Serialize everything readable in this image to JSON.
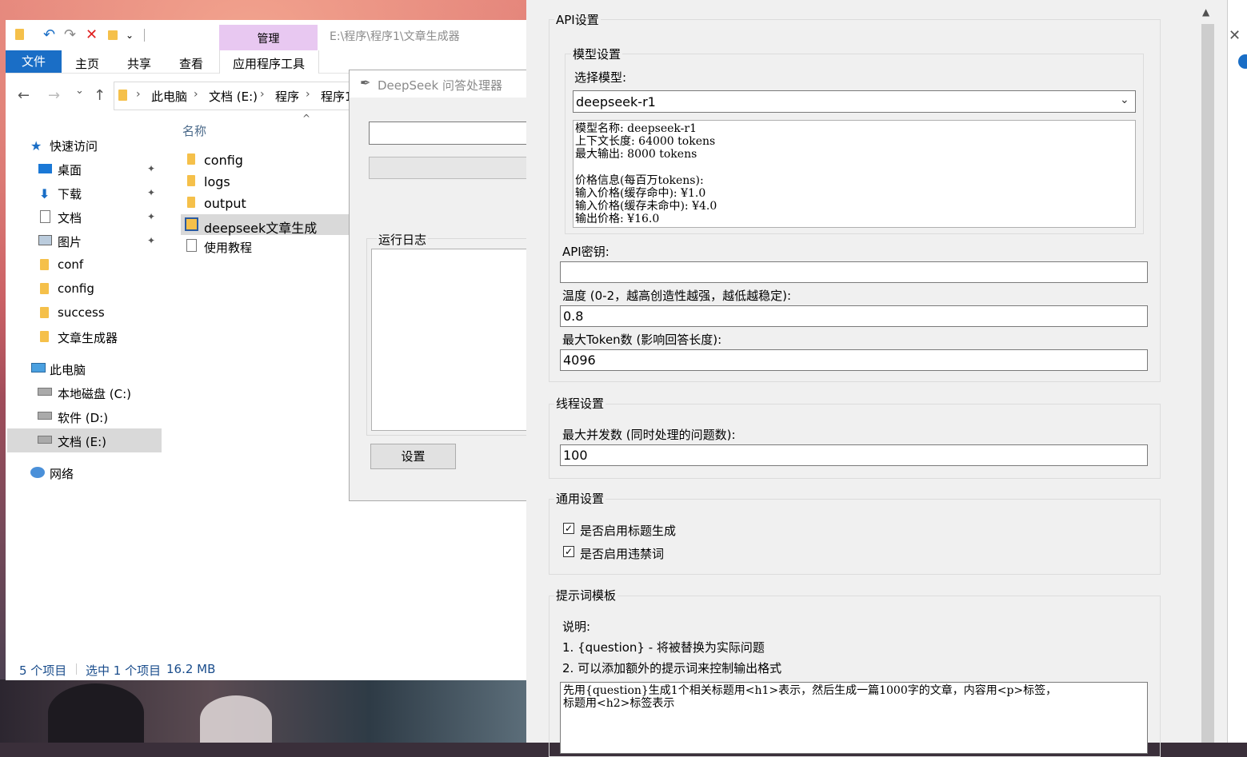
{
  "explorer": {
    "path_title": "E:\\程序\\程序1\\文章生成器",
    "manage_tab": "管理",
    "app_tools_tab": "应用程序工具",
    "ribbon_tabs": [
      "文件",
      "主页",
      "共享",
      "查看"
    ],
    "breadcrumbs": [
      "此电脑",
      "文档 (E:)",
      "程序",
      "程序1"
    ],
    "column_name": "名称",
    "nav": {
      "quick_access": "快速访问",
      "pinned": [
        "桌面",
        "下载",
        "文档",
        "图片"
      ],
      "folders": [
        "conf",
        "config",
        "success",
        "文章生成器"
      ],
      "this_pc": "此电脑",
      "drives": [
        "本地磁盘 (C:)",
        "软件 (D:)",
        "文档 (E:)"
      ],
      "network": "网络"
    },
    "files": [
      "config",
      "logs",
      "output",
      "deepseek文章生成",
      "使用教程"
    ],
    "status": {
      "count": "5 个项目",
      "selected": "选中 1 个项目",
      "size": "16.2 MB"
    }
  },
  "processor_window": {
    "title": "DeepSeek 问答处理器",
    "log_label": "运行日志",
    "settings_button": "设置"
  },
  "settings": {
    "api_section": "API设置",
    "model_section": "模型设置",
    "select_model_label": "选择模型:",
    "selected_model": "deepseek-r1",
    "model_info": [
      "模型名称: deepseek-r1",
      "上下文长度: 64000 tokens",
      "最大输出: 8000 tokens",
      "",
      "价格信息(每百万tokens):",
      "输入价格(缓存命中): ¥1.0",
      "输入价格(缓存未命中): ¥4.0",
      "输出价格: ¥16.0"
    ],
    "api_key_label": "API密钥:",
    "api_key_value": "",
    "temperature_label": "温度 (0-2，越高创造性越强，越低越稳定):",
    "temperature_value": "0.8",
    "max_tokens_label": "最大Token数 (影响回答长度):",
    "max_tokens_value": "4096",
    "thread_section": "线程设置",
    "max_concurrency_label": "最大并发数 (同时处理的问题数):",
    "max_concurrency_value": "100",
    "general_section": "通用设置",
    "enable_title_label": "是否启用标题生成",
    "enable_title_checked": true,
    "enable_banned_label": "是否启用违禁词",
    "enable_banned_checked": true,
    "prompt_section": "提示词模板",
    "note_title": "说明:",
    "note_1": "1. {question} - 将被替换为实际问题",
    "note_2": "2. 可以添加额外的提示词来控制输出格式",
    "prompt_lines": [
      "先用{question}生成1个相关标题用<h1>表示，然后生成一篇1000字的文章，内容用<p>标签，",
      "标题用<h2>标签表示"
    ],
    "check_mark": "✓"
  },
  "icons": {
    "undo": "↶",
    "redo": "↷",
    "delete": "✕",
    "back": "←",
    "forward": "→",
    "up": "↑",
    "chevron": "⌄",
    "pin": "📌",
    "close": "✕",
    "scroll_up": "▲",
    "sort_up": "^",
    "feather": "✒"
  }
}
